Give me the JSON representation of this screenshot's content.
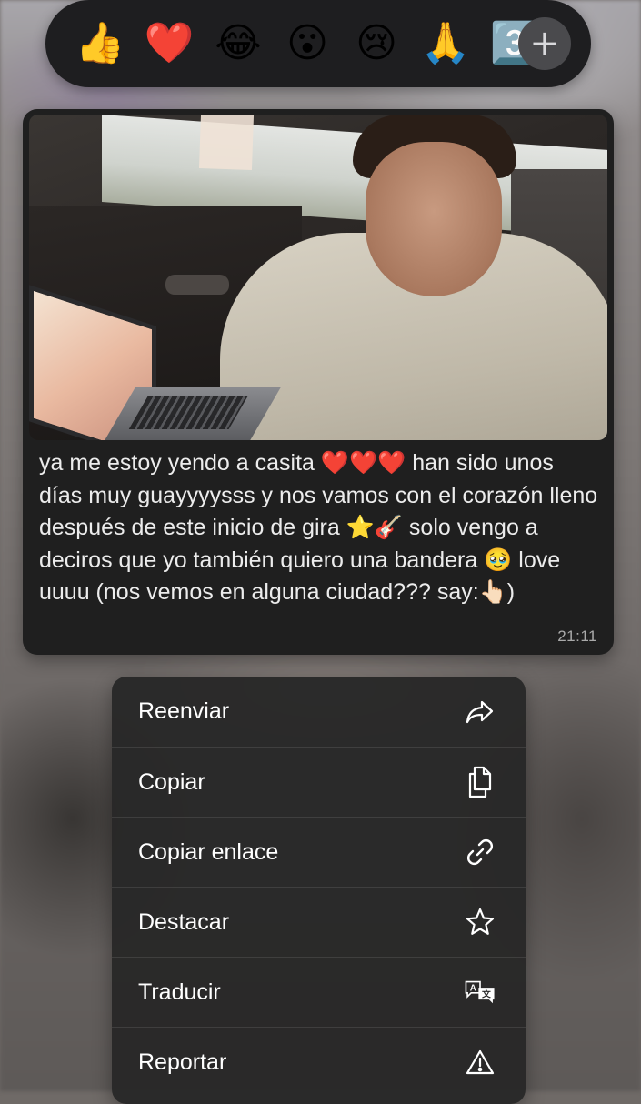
{
  "reactions": [
    {
      "emoji": "👍",
      "name": "thumbs-up"
    },
    {
      "emoji": "❤️",
      "name": "red-heart"
    },
    {
      "emoji": "😂",
      "name": "tears-of-joy"
    },
    {
      "emoji": "😮",
      "name": "surprised"
    },
    {
      "emoji": "😢",
      "name": "crying"
    },
    {
      "emoji": "🙏",
      "name": "folded-hands"
    },
    {
      "emoji": "3️⃣",
      "name": "keycap-three"
    }
  ],
  "add_reaction_label": "+",
  "message": {
    "text": "ya me estoy yendo a casita ❤️❤️❤️ han sido unos días muy guayyyysss y nos vamos con el corazón lleno después de este inicio de gira ⭐️🎸 solo vengo a deciros que yo también quiero una bandera 🥹 love uuuu (nos vemos en alguna ciudad??? say:👆🏻)",
    "time": "21:11"
  },
  "menu": {
    "items": [
      {
        "label": "Reenviar",
        "icon": "forward-icon"
      },
      {
        "label": "Copiar",
        "icon": "copy-icon"
      },
      {
        "label": "Copiar enlace",
        "icon": "link-icon"
      },
      {
        "label": "Destacar",
        "icon": "star-icon"
      },
      {
        "label": "Traducir",
        "icon": "translate-icon"
      },
      {
        "label": "Reportar",
        "icon": "warning-icon"
      }
    ]
  },
  "colors": {
    "menu_bg": "#282828",
    "bubble_bg": "#1f1f1f",
    "reaction_bar_bg": "#1e1e20",
    "text": "#ececec",
    "time": "#a9a9a9"
  }
}
